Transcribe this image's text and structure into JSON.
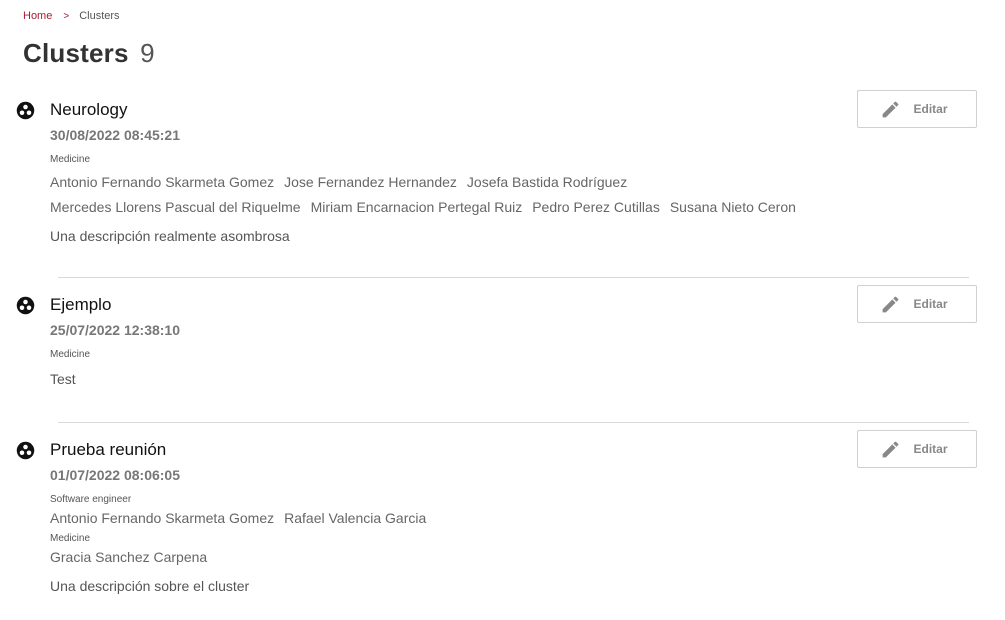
{
  "breadcrumb": {
    "home": "Home",
    "separator": ">",
    "current": "Clusters"
  },
  "page": {
    "title": "Clusters",
    "count": "9"
  },
  "colors": {
    "accent": "#a31d35",
    "divider": "#d9d9d9"
  },
  "clusters": [
    {
      "name": "Neurology",
      "date": "30/08/2022 08:45:21",
      "edit_label": "Editar",
      "icon": "cluster-icon",
      "groups": [
        {
          "label": "Medicine",
          "members": [
            "Antonio Fernando Skarmeta Gomez",
            "Jose Fernandez Hernandez",
            "Josefa Bastida Rodríguez",
            "Mercedes Llorens Pascual del Riquelme",
            "Miriam Encarnacion Pertegal Ruiz",
            "Pedro Perez Cutillas",
            "Susana Nieto Ceron"
          ]
        }
      ],
      "description": "Una descripción realmente asombrosa"
    },
    {
      "name": "Ejemplo",
      "date": "25/07/2022 12:38:10",
      "edit_label": "Editar",
      "icon": "cluster-icon",
      "groups": [
        {
          "label": "Medicine",
          "members": []
        }
      ],
      "description": "Test"
    },
    {
      "name": "Prueba reunión",
      "date": "01/07/2022 08:06:05",
      "edit_label": "Editar",
      "icon": "cluster-icon",
      "groups": [
        {
          "label": "Software engineer",
          "members": [
            "Antonio Fernando Skarmeta Gomez",
            "Rafael Valencia Garcia"
          ]
        },
        {
          "label": "Medicine",
          "members": [
            "Gracia Sanchez Carpena"
          ]
        }
      ],
      "description": "Una descripción sobre el cluster"
    }
  ]
}
